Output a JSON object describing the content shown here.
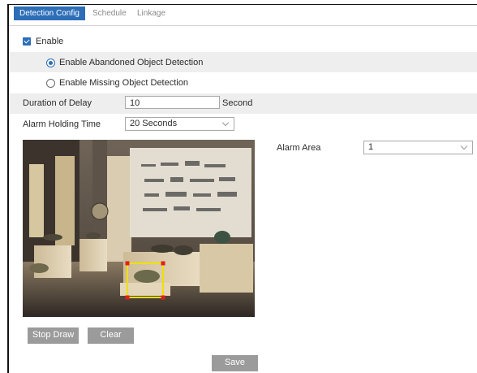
{
  "tabs": [
    {
      "label": "Detection Config",
      "active": true
    },
    {
      "label": "Schedule",
      "active": false
    },
    {
      "label": "Linkage",
      "active": false
    }
  ],
  "enable": {
    "label": "Enable",
    "checked": true
  },
  "mode_options": [
    {
      "label": "Enable Abandoned Object Detection",
      "selected": true
    },
    {
      "label": "Enable Missing Object Detection",
      "selected": false
    }
  ],
  "duration": {
    "label": "Duration of Delay",
    "value": "10",
    "unit": "Second"
  },
  "holding": {
    "label": "Alarm Holding Time",
    "value": "20 Seconds"
  },
  "alarm_area": {
    "label": "Alarm Area",
    "value": "1"
  },
  "buttons": {
    "stop_draw": "Stop Draw",
    "clear": "Clear",
    "save": "Save"
  },
  "colors": {
    "accent": "#2d6eb8",
    "shade_row": "#eeeeee",
    "button": "#9b9b9b",
    "detection_box": "#f0e000",
    "box_handle": "#e0201b"
  }
}
